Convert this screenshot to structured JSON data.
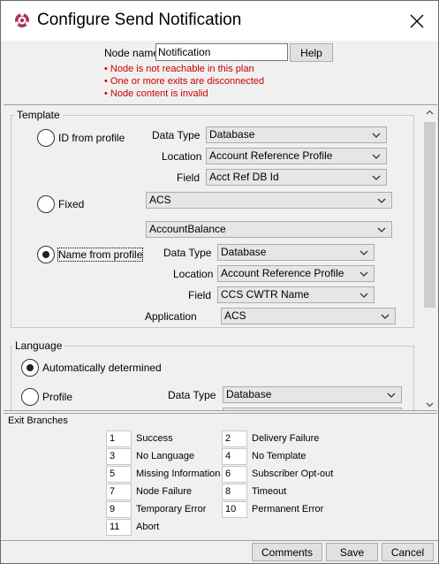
{
  "window": {
    "title": "Configure Send Notification"
  },
  "header": {
    "node_name_label": "Node name",
    "node_name_value": "Notification",
    "help_label": "Help",
    "errors": [
      "• Node is not reachable in this plan",
      "• One or more exits are disconnected",
      "• Node content is invalid"
    ]
  },
  "template": {
    "group_label": "Template",
    "id_from_profile": {
      "label": "ID from profile",
      "data_type_label": "Data Type",
      "data_type_value": "Database",
      "location_label": "Location",
      "location_value": "Account Reference Profile",
      "field_label": "Field",
      "field_value": "Acct Ref DB Id"
    },
    "fixed": {
      "label": "Fixed",
      "app_value": "ACS",
      "template_value": "AccountBalance"
    },
    "name_from_profile": {
      "label": "Name from profile",
      "data_type_label": "Data Type",
      "data_type_value": "Database",
      "location_label": "Location",
      "location_value": "Account Reference Profile",
      "field_label": "Field",
      "field_value": "CCS CWTR Name",
      "application_label": "Application",
      "application_value": "ACS"
    },
    "selected": "name_from_profile"
  },
  "language": {
    "group_label": "Language",
    "auto_label": "Automatically determined",
    "profile_label": "Profile",
    "data_type_label": "Data Type",
    "data_type_value": "Database",
    "selected": "auto"
  },
  "exit_branches": {
    "group_label": "Exit Branches",
    "left": [
      {
        "num": "1",
        "label": "Success"
      },
      {
        "num": "3",
        "label": "No Language"
      },
      {
        "num": "5",
        "label": "Missing Information"
      },
      {
        "num": "7",
        "label": "Node Failure"
      },
      {
        "num": "9",
        "label": "Temporary Error"
      },
      {
        "num": "11",
        "label": "Abort"
      }
    ],
    "right": [
      {
        "num": "2",
        "label": "Delivery Failure"
      },
      {
        "num": "4",
        "label": "No Template"
      },
      {
        "num": "6",
        "label": "Subscriber Opt-out"
      },
      {
        "num": "8",
        "label": "Timeout"
      },
      {
        "num": "10",
        "label": "Permanent Error"
      }
    ]
  },
  "footer": {
    "comments_label": "Comments",
    "save_label": "Save",
    "cancel_label": "Cancel"
  },
  "colors": {
    "error": "#c80000",
    "window_bg": "#f0f0f0",
    "logo": "#b0305a"
  }
}
